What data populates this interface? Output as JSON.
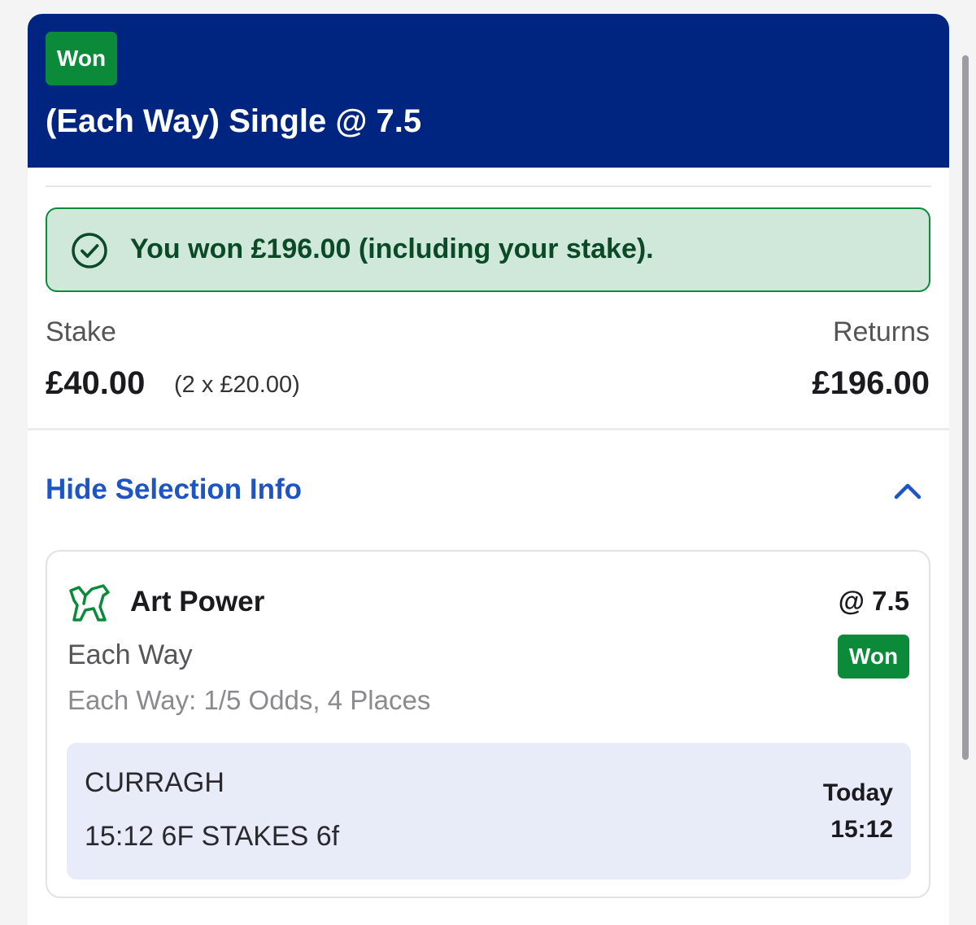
{
  "header": {
    "status_badge": "Won",
    "title": "(Each Way) Single @ 7.5",
    "background_color": "#002580"
  },
  "win_banner": {
    "icon": "check-circle-icon",
    "message": "You won £196.00 (including your stake)."
  },
  "stake": {
    "label": "Stake",
    "value": "£40.00",
    "breakdown": "(2 x £20.00)"
  },
  "returns": {
    "label": "Returns",
    "value": "£196.00"
  },
  "selection_toggle": {
    "label": "Hide Selection Info",
    "icon": "chevron-up-icon"
  },
  "selection": {
    "icon": "horse-racing-icon",
    "runner": "Art Power",
    "odds": "@ 7.5",
    "market": "Each Way",
    "status_badge": "Won",
    "each_way_terms": "Each Way: 1/5 Odds, 4 Places",
    "event": {
      "venue": "CURRAGH",
      "race": "15:12 6F STAKES 6f",
      "day": "Today",
      "time": "15:12"
    }
  },
  "colors": {
    "accent_blue": "#1d55c4",
    "won_green": "#0b8a3a",
    "banner_bg": "#cfe8da"
  }
}
